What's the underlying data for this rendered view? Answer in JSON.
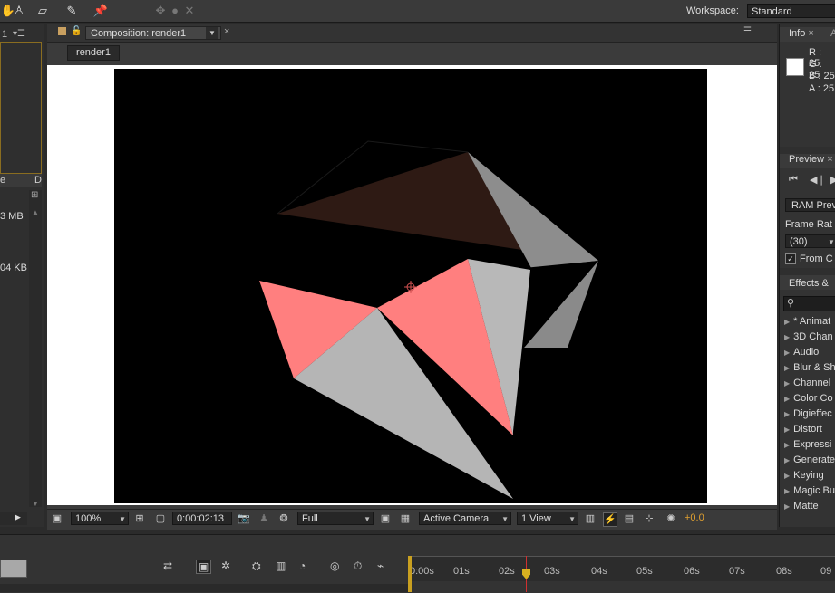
{
  "toolbar": {
    "workspace_label": "Workspace:",
    "workspace_value": "Standard"
  },
  "project": {
    "item_sizes": [
      "3 MB",
      "04 KB"
    ]
  },
  "composition": {
    "tab_label": "Composition: render1",
    "breadcrumb": "render1"
  },
  "viewer_controls": {
    "zoom": "100%",
    "timecode": "0:00:02:13",
    "resolution": "Full",
    "camera": "Active Camera",
    "views": "1 View",
    "exposure": "+0.0"
  },
  "info_panel": {
    "tab": "Info",
    "tab_alt": "A",
    "r": "R : 25",
    "g": "G : 25",
    "b": "B : 25",
    "a": "A : 25"
  },
  "preview_panel": {
    "tab": "Preview",
    "ram_preview": "RAM Prev",
    "frame_rate_label": "Frame Rat",
    "frame_rate_value": "(30)",
    "from_current": "From C"
  },
  "effects_panel": {
    "tab": "Effects &",
    "items": [
      "* Animat",
      "3D Chan",
      "Audio",
      "Blur & Sh",
      "Channel",
      "Color Co",
      "Digieffec",
      "Distort",
      "Expressi",
      "Generate",
      "Keying",
      "Magic Bu",
      "Matte"
    ]
  },
  "timeline": {
    "ticks": [
      "0:00s",
      "01s",
      "02s",
      "03s",
      "04s",
      "05s",
      "06s",
      "07s",
      "08s",
      "09"
    ]
  },
  "colors": {
    "accent_pink": "#ff7f7f",
    "shape_gray": "#b8b8b8",
    "shape_brown": "#2e1a14",
    "exposure_orange": "#e0a030",
    "cti_yellow": "#d8b020"
  }
}
